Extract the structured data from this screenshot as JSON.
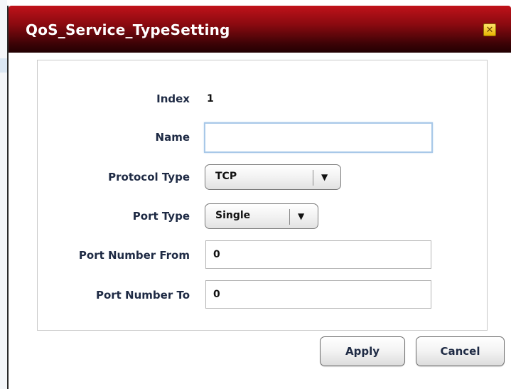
{
  "dialog": {
    "title": "QoS_Service_TypeSetting",
    "close_glyph": "✕",
    "close_icon": "close-icon"
  },
  "form": {
    "index_label": "Index",
    "index_value": "1",
    "name_label": "Name",
    "name_value": "",
    "protocol_label": "Protocol Type",
    "protocol_value": "TCP",
    "port_type_label": "Port Type",
    "port_type_value": "Single",
    "port_from_label": "Port Number From",
    "port_from_value": "0",
    "port_to_label": "Port Number To",
    "port_to_value": "0",
    "dropdown_arrow": "▼"
  },
  "buttons": {
    "apply": "Apply",
    "cancel": "Cancel"
  },
  "colors": {
    "titlebar_top": "#c0121a",
    "titlebar_bottom": "#220002",
    "label_text": "#1e2a44",
    "focus_border": "#a8c8e8"
  }
}
